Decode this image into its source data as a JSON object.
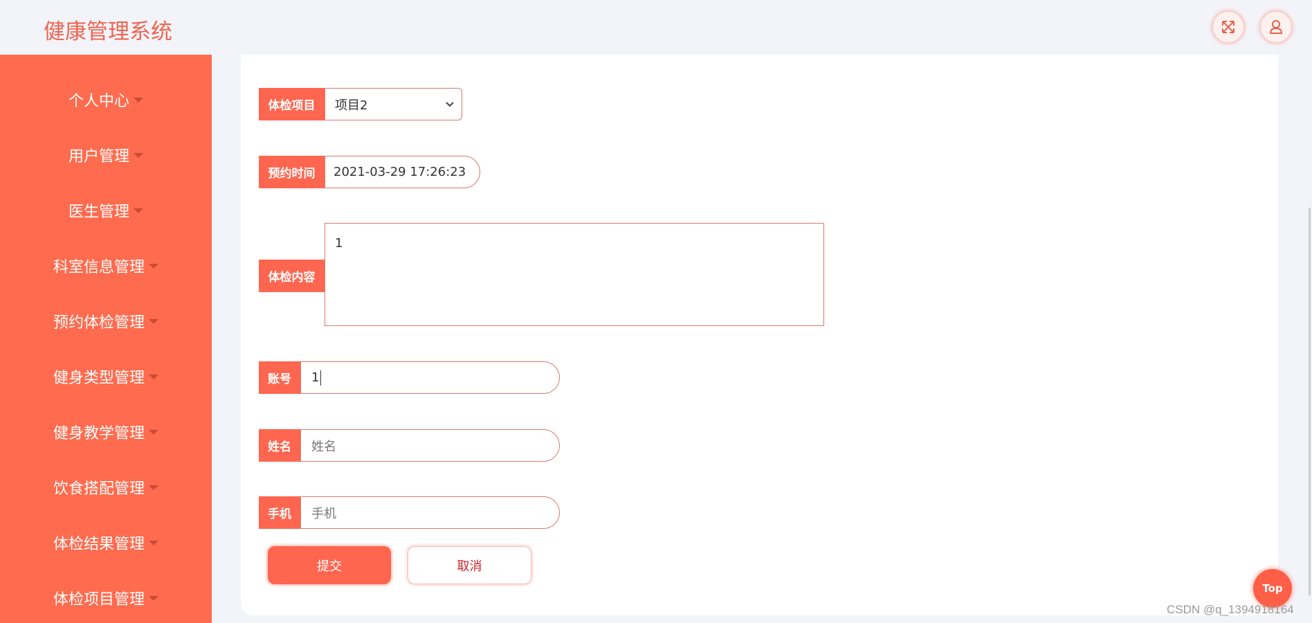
{
  "header": {
    "title": "健康管理系统",
    "icons": [
      "fullscreen-icon",
      "user-icon"
    ]
  },
  "sidebar": {
    "items": [
      {
        "label": "个人中心"
      },
      {
        "label": "用户管理"
      },
      {
        "label": "医生管理"
      },
      {
        "label": "科室信息管理"
      },
      {
        "label": "预约体检管理"
      },
      {
        "label": "健身类型管理"
      },
      {
        "label": "健身教学管理"
      },
      {
        "label": "饮食搭配管理"
      },
      {
        "label": "体检结果管理"
      },
      {
        "label": "体检项目管理"
      }
    ]
  },
  "form": {
    "project": {
      "label": "体检项目",
      "value": "项目2"
    },
    "time": {
      "label": "预约时间",
      "value": "2021-03-29 17:26:23"
    },
    "content": {
      "label": "体检内容",
      "value": "1"
    },
    "account": {
      "label": "账号",
      "value": "1"
    },
    "name": {
      "label": "姓名",
      "placeholder": "姓名"
    },
    "phone": {
      "label": "手机",
      "placeholder": "手机"
    },
    "submit": "提交",
    "cancel": "取消"
  },
  "top_button": "Top",
  "watermark": "CSDN @q_1394918164",
  "colors": {
    "accent": "#ff6b4e",
    "title": "#f06450",
    "cancel_text": "#d0202a"
  }
}
